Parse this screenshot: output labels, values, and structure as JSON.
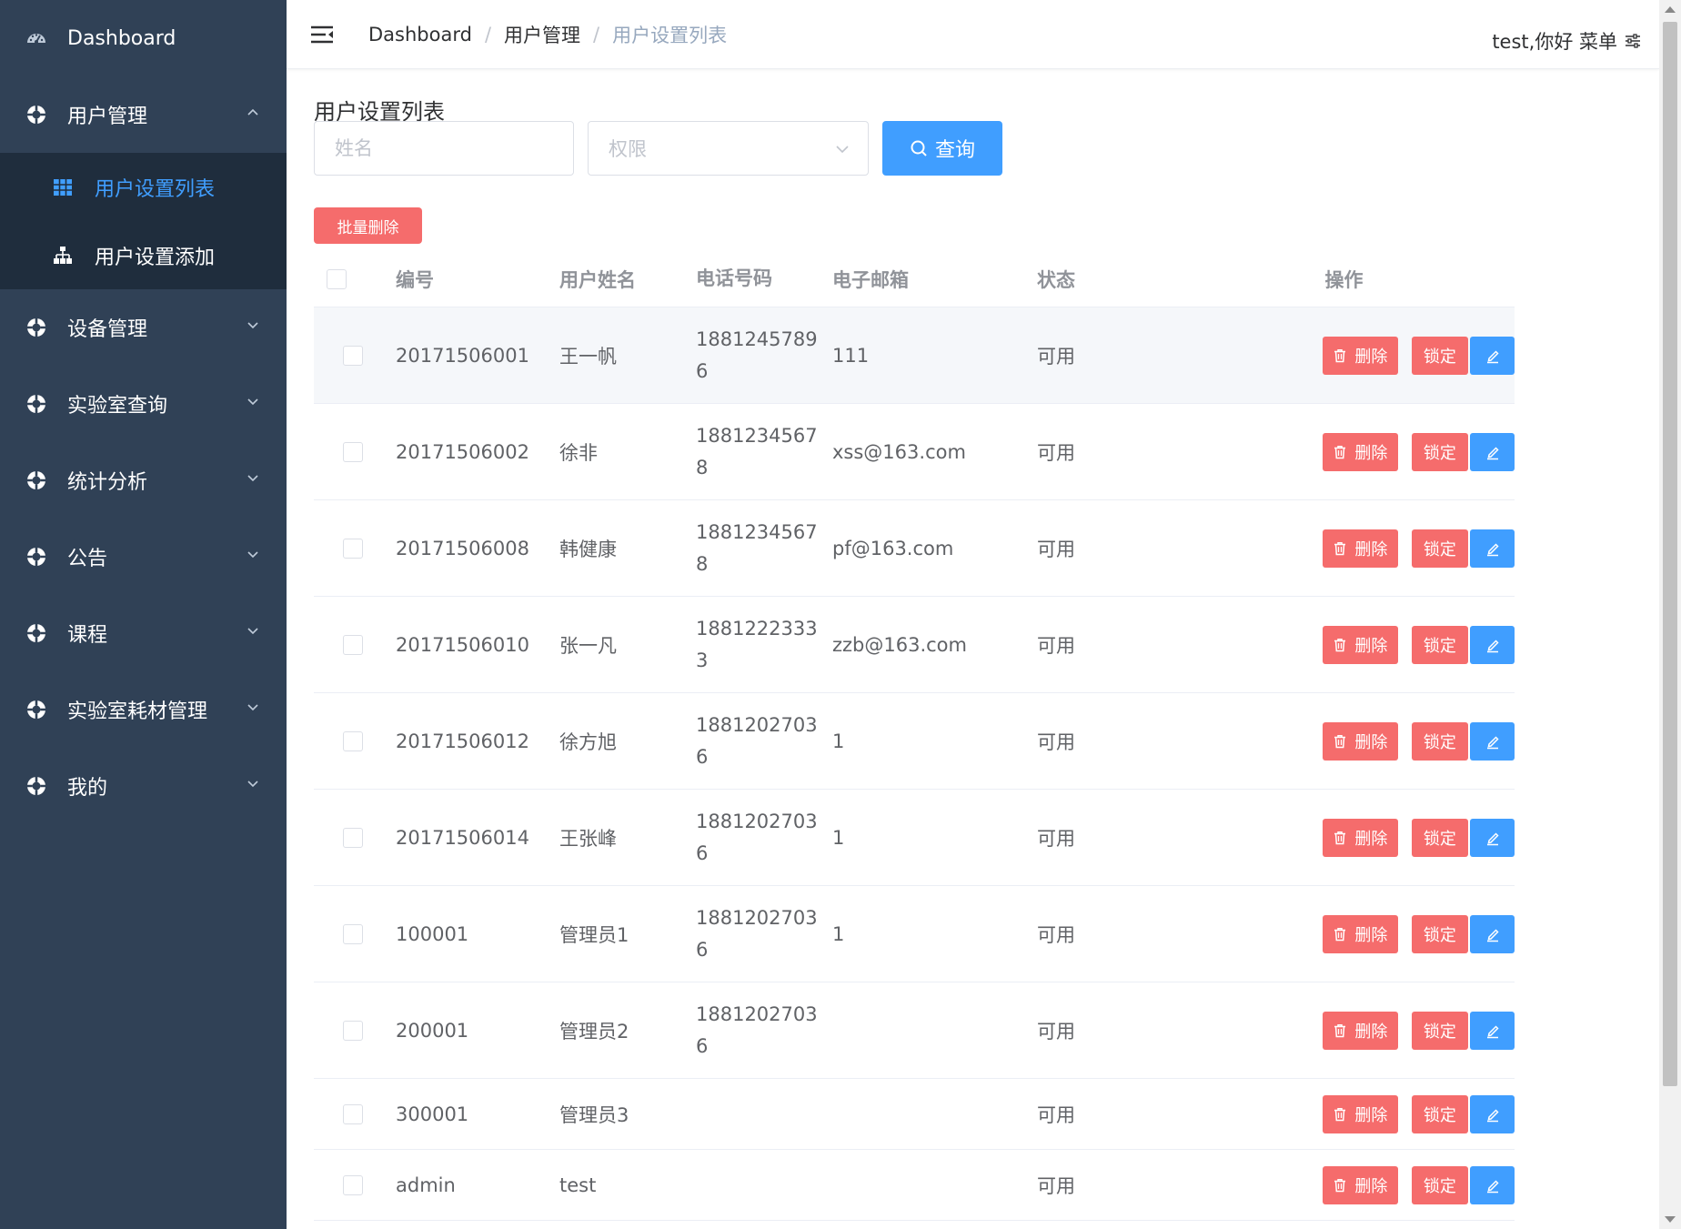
{
  "sidebar": {
    "dashboard": "Dashboard",
    "menus": [
      {
        "label": "用户管理",
        "expanded": true
      },
      {
        "label": "设备管理",
        "expanded": false
      },
      {
        "label": "实验室查询",
        "expanded": false
      },
      {
        "label": "统计分析",
        "expanded": false
      },
      {
        "label": "公告",
        "expanded": false
      },
      {
        "label": "课程",
        "expanded": false
      },
      {
        "label": "实验室耗材管理",
        "expanded": false
      },
      {
        "label": "我的",
        "expanded": false
      }
    ],
    "submenu": [
      {
        "label": "用户设置列表",
        "active": true,
        "icon": "table-icon"
      },
      {
        "label": "用户设置添加",
        "active": false,
        "icon": "tree-icon"
      }
    ]
  },
  "header": {
    "breadcrumb": [
      "Dashboard",
      "用户管理",
      "用户设置列表"
    ],
    "user_menu": "test,你好 菜单"
  },
  "page": {
    "title": "用户设置列表",
    "name_placeholder": "姓名",
    "perm_placeholder": "权限",
    "query_label": "查询",
    "batch_delete_label": "批量删除"
  },
  "table": {
    "columns": [
      "编号",
      "用户姓名",
      "电话号码",
      "电子邮箱",
      "状态",
      "操作"
    ],
    "actions": {
      "delete": "删除",
      "lock": "锁定"
    },
    "rows": [
      {
        "id": "20171506001",
        "name": "王一帆",
        "phone": "18812457896",
        "email": "111",
        "status": "可用"
      },
      {
        "id": "20171506002",
        "name": "徐非",
        "phone": "18812345678",
        "email": "xss@163.com",
        "status": "可用"
      },
      {
        "id": "20171506008",
        "name": "韩健康",
        "phone": "18812345678",
        "email": "pf@163.com",
        "status": "可用"
      },
      {
        "id": "20171506010",
        "name": "张一凡",
        "phone": "18812223333",
        "email": "zzb@163.com",
        "status": "可用"
      },
      {
        "id": "20171506012",
        "name": "徐方旭",
        "phone": "18812027036",
        "email": "1",
        "status": "可用"
      },
      {
        "id": "20171506014",
        "name": "王张峰",
        "phone": "18812027036",
        "email": "1",
        "status": "可用"
      },
      {
        "id": "100001",
        "name": "管理员1",
        "phone": "18812027036",
        "email": "1",
        "status": "可用"
      },
      {
        "id": "200001",
        "name": "管理员2",
        "phone": "18812027036",
        "email": "",
        "status": "可用"
      },
      {
        "id": "300001",
        "name": "管理员3",
        "phone": "",
        "email": "",
        "status": "可用"
      },
      {
        "id": "admin",
        "name": "test",
        "phone": "",
        "email": "",
        "status": "可用"
      }
    ]
  },
  "colors": {
    "sidebar_bg": "#304156",
    "submenu_bg": "#1f2d3d",
    "primary": "#409eff",
    "danger": "#f56c6c"
  }
}
